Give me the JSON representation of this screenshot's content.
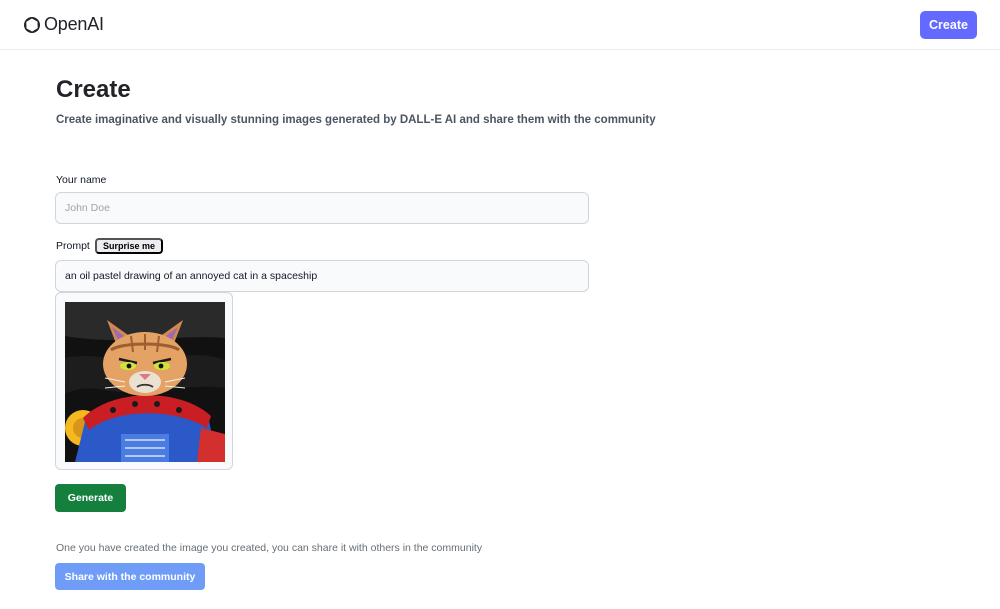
{
  "header": {
    "logo_text": "OpenAI",
    "create_button": "Create"
  },
  "main": {
    "title": "Create",
    "subtitle": "Create imaginative and visually stunning images generated by DALL-E AI and share them with the community"
  },
  "form": {
    "name_label": "Your name",
    "name_placeholder": "John Doe",
    "prompt_label": "Prompt",
    "surprise_button": "Surprise me",
    "prompt_value": "an oil pastel drawing of an annoyed cat in a spaceship",
    "generated_image": "oil pastel drawing of an orange tabby cat in a blue and red space suit",
    "generate_button": "Generate"
  },
  "share": {
    "note": "One you have created the image you created, you can share it with others in the community",
    "button": "Share with the community"
  },
  "colors": {
    "brand": "#6469ff",
    "generate": "#15803d",
    "share": "#6f9cf7"
  },
  "icons": {
    "logo": "openai-logo-icon"
  }
}
